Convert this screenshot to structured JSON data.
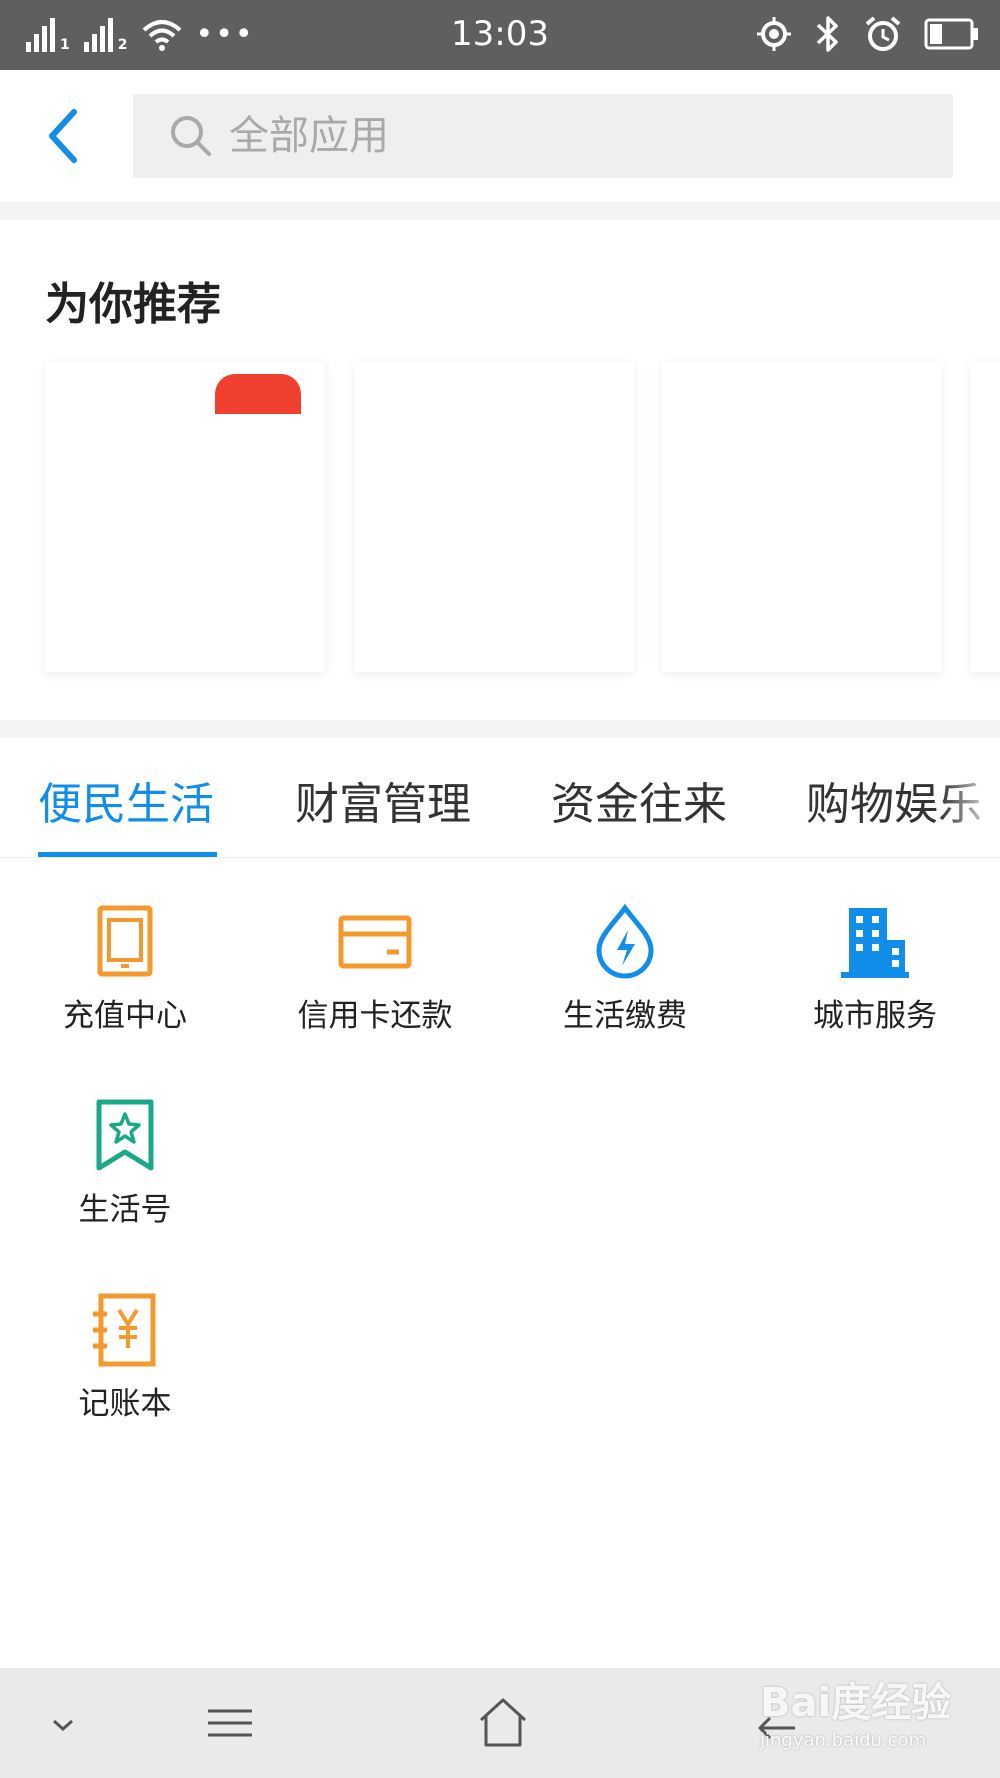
{
  "status_bar": {
    "time": "13:03",
    "sim1_label": "1",
    "sim2_label": "2",
    "icons": [
      "signal-icon",
      "wifi-icon",
      "more-icon",
      "location-icon",
      "bluetooth-icon",
      "alarm-icon",
      "battery-icon"
    ]
  },
  "header": {
    "search_placeholder": "全部应用",
    "back_icon": "back-chevron-icon"
  },
  "recommend": {
    "title": "为你推荐",
    "cards": [
      {
        "has_badge": true
      },
      {
        "has_badge": false
      },
      {
        "has_badge": false
      },
      {
        "has_badge": false
      }
    ]
  },
  "tabs": [
    {
      "label": "便民生活",
      "active": true
    },
    {
      "label": "财富管理",
      "active": false
    },
    {
      "label": "资金往来",
      "active": false
    },
    {
      "label": "购物娱乐",
      "active": false
    }
  ],
  "apps": [
    {
      "label": "充值中心",
      "icon": "phone-recharge-icon",
      "color": "#f29a2e"
    },
    {
      "label": "信用卡还款",
      "icon": "credit-card-icon",
      "color": "#f29a2e"
    },
    {
      "label": "生活缴费",
      "icon": "water-drop-bolt-icon",
      "color": "#108ee9"
    },
    {
      "label": "城市服务",
      "icon": "building-icon",
      "color": "#108ee9"
    },
    {
      "label": "生活号",
      "icon": "bookmark-star-icon",
      "color": "#1aa88a"
    },
    {
      "label": "记账本",
      "icon": "ledger-yuan-icon",
      "color": "#f29a2e"
    }
  ],
  "nav_bar": {
    "icons": [
      "collapse-chevron-icon",
      "menu-icon",
      "home-icon",
      "back-arrow-icon"
    ]
  },
  "watermark": {
    "main": "Bai度经验",
    "sub": "jingyan.baidu.com"
  },
  "colors": {
    "accent": "#108ee9",
    "orange": "#f29a2e",
    "green": "#1aa88a",
    "badge_red": "#f1402f",
    "status_bar_bg": "#5f5f5f"
  }
}
